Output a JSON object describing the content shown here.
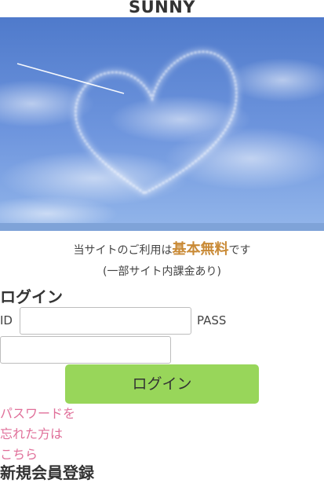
{
  "site": {
    "title": "SUNNY"
  },
  "hero": {
    "image": "heart-skywriting-in-blue-sky"
  },
  "intro": {
    "prefix": "当サイトのご利用は",
    "highlight": "基本無料",
    "suffix": "です",
    "note": "(一部サイト内課金あり)"
  },
  "login": {
    "heading": "ログイン",
    "id_label": "ID",
    "id_value": "",
    "pass_label": "PASS",
    "pass_value": "",
    "button_label": "ログイン",
    "forgot_line1": "パスワードを",
    "forgot_line2": "忘れた方は",
    "forgot_line3": "こちら"
  },
  "register": {
    "heading": "新規会員登録"
  },
  "colors": {
    "accent_highlight": "#c98a36",
    "login_button": "#98d65a",
    "link": "#e0709a",
    "sky_top": "#5a84d4",
    "sky_bottom": "#8fb4ea"
  }
}
